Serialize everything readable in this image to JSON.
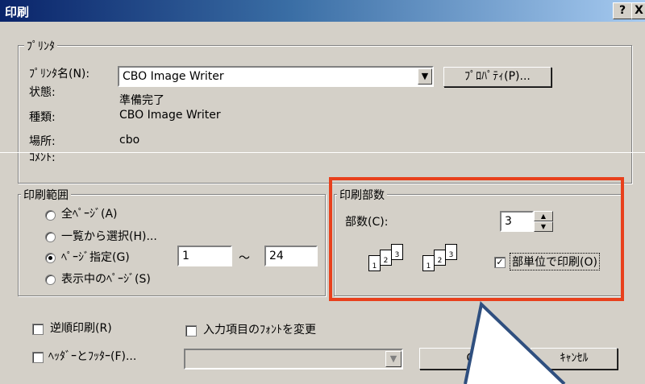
{
  "window": {
    "title": "印刷",
    "help_label": "?",
    "close_label": "X"
  },
  "printer": {
    "legend": "ﾌﾟﾘﾝﾀ",
    "name_label": "ﾌﾟﾘﾝﾀ名(N):",
    "name_value": "CBO Image Writer",
    "properties_button": "ﾌﾟﾛﾊﾟﾃｨ(P)...",
    "status_label": "状態:",
    "status_value": "準備完了",
    "type_label": "種類:",
    "type_value": "CBO Image Writer",
    "location_label": "場所:",
    "location_value": "cbo",
    "comment_label": "ｺﾒﾝﾄ:"
  },
  "range": {
    "legend": "印刷範囲",
    "options": [
      "全ﾍﾟｰｼﾞ(A)",
      "一覧から選択(H)...",
      "ﾍﾟｰｼﾞ指定(G)",
      "表示中のﾍﾟｰｼﾞ(S)"
    ],
    "selected_index": 2,
    "from_value": "1",
    "separator": "～",
    "to_value": "24"
  },
  "copies": {
    "legend": "印刷部数",
    "count_label": "部数(C):",
    "count_value": "3",
    "collate_label": "部単位で印刷(O)",
    "collate_checked": true,
    "page_numbers": [
      "1",
      "2",
      "3"
    ]
  },
  "options": {
    "reverse_label": "逆順印刷(R)",
    "header_footer_label": "ﾍｯﾀﾞｰとﾌｯﾀｰ(F)...",
    "font_change_label": "入力項目のﾌｫﾝﾄを変更"
  },
  "buttons": {
    "ok_partial": "O",
    "cancel_label": "ｷｬﾝｾﾙ"
  },
  "annotation": {
    "highlight_color": "#e8401c",
    "callout_color": "#2f4f7f"
  }
}
